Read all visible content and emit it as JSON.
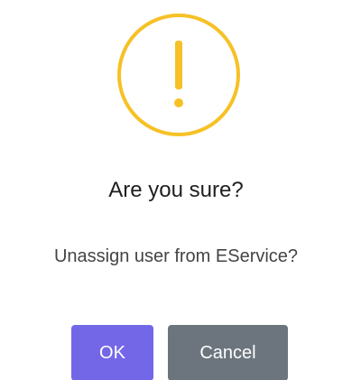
{
  "dialog": {
    "icon": "warning-exclamation-icon",
    "icon_color": "#f6c126",
    "title": "Are you sure?",
    "text": "Unassign user from EService?",
    "confirm_label": "OK",
    "cancel_label": "Cancel",
    "confirm_color": "#7367e8",
    "cancel_color": "#6c757d"
  }
}
